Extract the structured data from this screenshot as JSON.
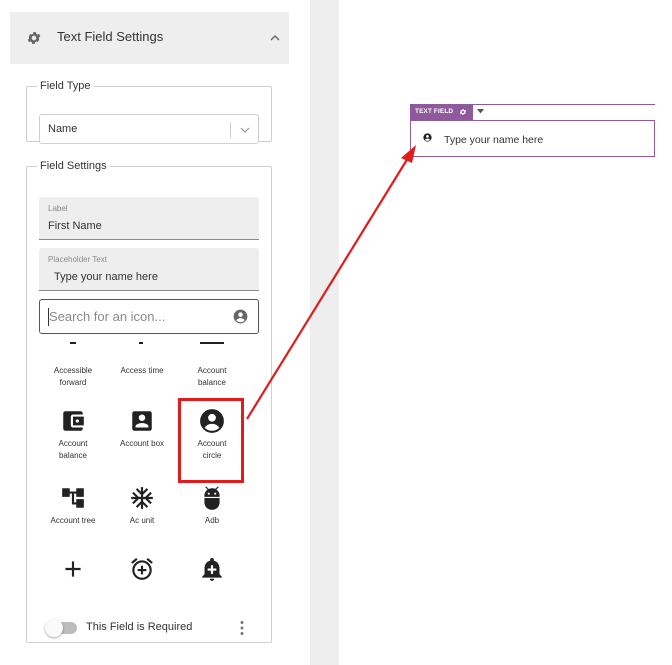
{
  "panel": {
    "title": "Text Field Settings",
    "field_type": {
      "legend": "Field Type",
      "selected": "Name"
    },
    "field_settings": {
      "legend": "Field Settings",
      "label_caption": "Label",
      "label_value": "First Name",
      "placeholder_caption": "Placeholder Text",
      "placeholder_value": "Type your name here",
      "search_placeholder": "Search for an icon..."
    },
    "icons": [
      {
        "name": "Accessible forward",
        "line1": "Accessible",
        "line2": "forward",
        "icon": "accessible-forward-icon"
      },
      {
        "name": "Access time",
        "line1": "Access time",
        "line2": "",
        "icon": "access-time-icon"
      },
      {
        "name": "Account balance",
        "line1": "Account",
        "line2": "balance",
        "icon": "account-balance-icon"
      },
      {
        "name": "Account balance wallet",
        "line1": "Account",
        "line2": "balance",
        "icon": "account-balance-wallet-icon"
      },
      {
        "name": "Account box",
        "line1": "Account box",
        "line2": "",
        "icon": "account-box-icon"
      },
      {
        "name": "Account circle",
        "line1": "Account",
        "line2": "circle",
        "icon": "account-circle-icon",
        "selected": true
      },
      {
        "name": "Account tree",
        "line1": "Account tree",
        "line2": "",
        "icon": "account-tree-icon"
      },
      {
        "name": "Ac unit",
        "line1": "Ac unit",
        "line2": "",
        "icon": "ac-unit-icon"
      },
      {
        "name": "Adb",
        "line1": "Adb",
        "line2": "",
        "icon": "adb-icon"
      },
      {
        "name": "Add",
        "line1": "",
        "line2": "",
        "icon": "add-icon"
      },
      {
        "name": "Add alarm",
        "line1": "",
        "line2": "",
        "icon": "add-alarm-icon"
      },
      {
        "name": "Add alert",
        "line1": "",
        "line2": "",
        "icon": "add-alert-icon"
      }
    ],
    "required_label": "This Field is Required",
    "required_on": false
  },
  "preview": {
    "tag": "TEXT FIELD",
    "placeholder": "Type your name here",
    "icon": "account-circle-icon"
  },
  "colors": {
    "accent": "#8e5a9b",
    "highlight": "#e21c1c",
    "header_bg": "#eeeeee"
  }
}
